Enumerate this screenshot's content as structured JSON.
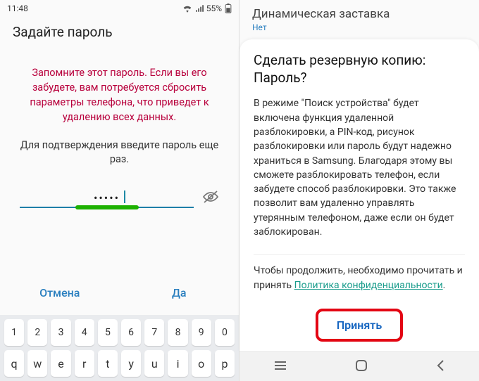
{
  "left": {
    "status": {
      "time": "11:48",
      "battery": "55%"
    },
    "title": "Задайте пароль",
    "warning": "Запомните этот пароль. Если вы его забудете, вам потребуется сбросить параметры телефона, что приведет к удалению всех данных.",
    "subtext": "Для подтверждения введите пароль еще раз.",
    "password_dots": "•••••",
    "buttons": {
      "cancel": "Отмена",
      "ok": "Да"
    },
    "keyboard": {
      "row1": [
        "1",
        "2",
        "3",
        "4",
        "5",
        "6",
        "7",
        "8",
        "9",
        "0"
      ],
      "row2": [
        "q",
        "w",
        "e",
        "r",
        "t",
        "y",
        "u",
        "i",
        "o",
        "p"
      ]
    }
  },
  "right": {
    "header": {
      "title": "Динамическая заставка",
      "value": "Нет"
    },
    "sheet": {
      "title": "Сделать резервную копию: Пароль?",
      "body": "В режиме \"Поиск устройства\" будет включена функция удаленной разблокировки, а PIN-код, рисунок разблокировки или пароль будут надежно храниться в Samsung. Благодаря этому вы сможете разблокировать телефон, если забудете способ разблокировки. Это также позволит вам удаленно управлять утерянным телефоном, даже если он будет заблокирован.",
      "footer_prefix": "Чтобы продолжить, необходимо прочитать и принять ",
      "footer_link": "Политика конфиденциальности",
      "footer_suffix": ".",
      "accept": "Принять"
    }
  }
}
